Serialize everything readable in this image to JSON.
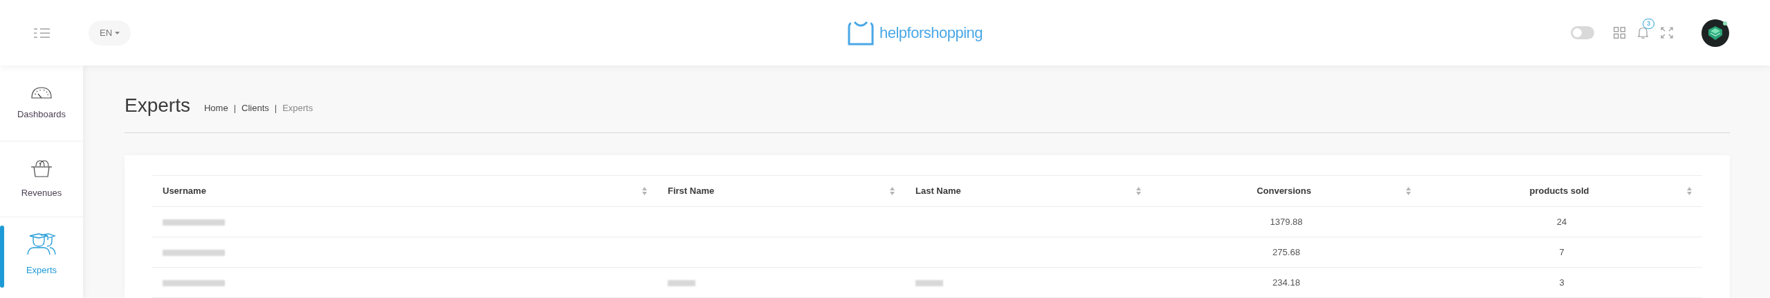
{
  "header": {
    "language": "EN",
    "logo_text": "helpforshopping",
    "theme_toggle": {
      "on": false
    },
    "notifications_badge": "3"
  },
  "sidebar": {
    "items": [
      {
        "label": "Dashboards",
        "kind": "gauge",
        "selected": false
      },
      {
        "label": "Revenues",
        "kind": "basket",
        "selected": false
      },
      {
        "label": "Experts",
        "kind": "graduates",
        "selected": true
      }
    ]
  },
  "page": {
    "title": "Experts",
    "breadcrumb_separator": "|",
    "breadcrumbs": [
      "Home",
      "Clients",
      "Experts"
    ]
  },
  "table": {
    "columns": [
      {
        "label": "Username",
        "kind": "text"
      },
      {
        "label": "First Name",
        "kind": "text"
      },
      {
        "label": "Last Name",
        "kind": "text"
      },
      {
        "label": "Conversions",
        "kind": "number"
      },
      {
        "label": "products sold",
        "kind": "number"
      }
    ],
    "rows": [
      {
        "cells": [
          {
            "kind": "redacted"
          },
          {
            "kind": "empty"
          },
          {
            "kind": "empty"
          },
          {
            "kind": "text",
            "text": "1379.88"
          },
          {
            "kind": "text",
            "text": "24"
          }
        ]
      },
      {
        "cells": [
          {
            "kind": "redacted"
          },
          {
            "kind": "empty"
          },
          {
            "kind": "empty"
          },
          {
            "kind": "text",
            "text": "275.68"
          },
          {
            "kind": "text",
            "text": "7"
          }
        ]
      },
      {
        "cells": [
          {
            "kind": "redacted"
          },
          {
            "kind": "redacted"
          },
          {
            "kind": "redacted"
          },
          {
            "kind": "text",
            "text": "234.18"
          },
          {
            "kind": "text",
            "text": "3"
          }
        ]
      }
    ]
  }
}
